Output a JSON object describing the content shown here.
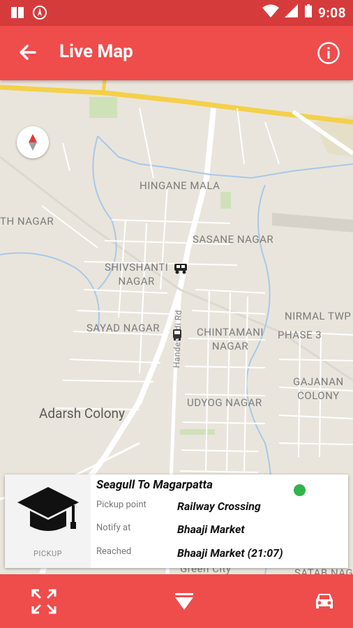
{
  "status_bar": {
    "time": "9:08"
  },
  "app_bar": {
    "title": "Live Map"
  },
  "map": {
    "labels": {
      "hingane_mala": "HINGANE MALA",
      "th_nagar": "TH NAGAR",
      "sasane_nagar": "SASANE NAGAR",
      "shivshanti_nagar": "SHIVSHANTI\nNAGAR",
      "nirmal_twp": "NIRMAL TWP",
      "phase_3": "PHASE 3",
      "sayad_nagar": "SAYAD NAGAR",
      "chintamani_nagar": "CHINTAMANI\nNAGAR",
      "handewadi_rd": "Handewadi Rd",
      "gajanan_colony": "GAJANAN\nCOLONY",
      "udyog_nagar": "UDYOG NAGAR",
      "adarsh_colony": "Adarsh Colony",
      "green_city": "Green City",
      "satab_nagar": "SATAB NAGAR"
    }
  },
  "info_card": {
    "thumb_label": "PICKUP",
    "route_title": "Seagull To Magarpatta",
    "status_color": "#2fb34a",
    "rows": [
      {
        "label": "Pickup point",
        "value": "Railway Crossing"
      },
      {
        "label": "Notify at",
        "value": "Bhaaji Market"
      },
      {
        "label": "Reached",
        "value": "Bhaaji Market (21:07)"
      }
    ]
  },
  "colors": {
    "primary": "#ef4c4c",
    "primary_dark": "#d63b3b"
  }
}
